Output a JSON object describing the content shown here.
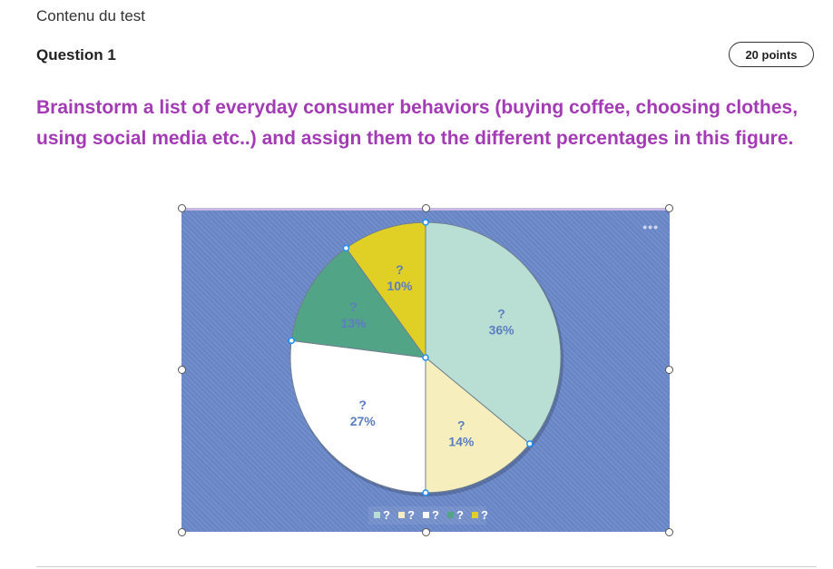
{
  "header": {
    "breadcrumb": "Contenu du test",
    "question_title": "Question 1",
    "points": "20 points"
  },
  "prompt": "Brainstorm a list of everyday consumer behaviors (buying coffee, choosing clothes, using social media etc..) and assign them to the different percentages in this figure.",
  "figure": {
    "more_icon": "more-options-icon",
    "dots": "•••"
  },
  "chart_data": {
    "type": "pie",
    "title": "",
    "slices": [
      {
        "label": "?",
        "value": 36,
        "value_label": "36%",
        "color": "#b9ded3"
      },
      {
        "label": "?",
        "value": 14,
        "value_label": "14%",
        "color": "#f6efbd"
      },
      {
        "label": "?",
        "value": 27,
        "value_label": "27%",
        "color": "#ffffff"
      },
      {
        "label": "?",
        "value": 13,
        "value_label": "13%",
        "color": "#52a486"
      },
      {
        "label": "?",
        "value": 10,
        "value_label": "10%",
        "color": "#e0cf25"
      }
    ],
    "label_color": "#5b7ec0",
    "legend": {
      "placement": "bottom",
      "entries": [
        "?",
        "?",
        "?",
        "?",
        "?"
      ]
    }
  }
}
